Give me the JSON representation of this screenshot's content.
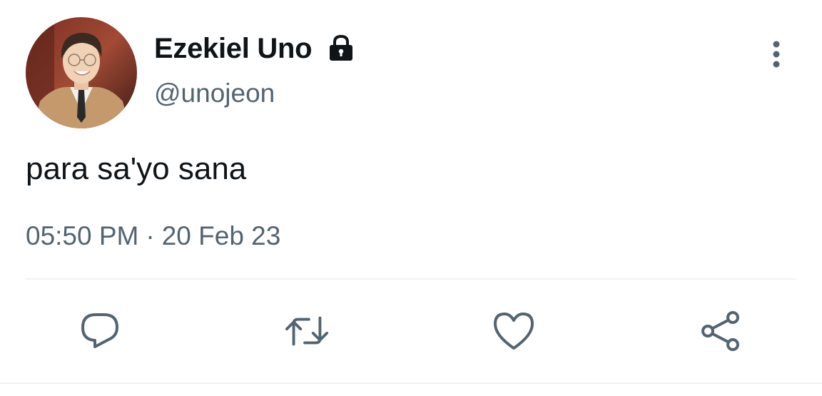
{
  "tweet": {
    "author": {
      "display_name": "Ezekiel Uno",
      "handle": "@unojeon",
      "protected_icon": "lock-icon",
      "avatar": "avatar"
    },
    "text": "para sa'yo sana",
    "time": "05:50 PM",
    "separator": "·",
    "date": "20 Feb 23",
    "more_icon": "more-vertical-icon"
  },
  "actions": [
    {
      "name": "reply",
      "icon": "reply-icon"
    },
    {
      "name": "retweet",
      "icon": "retweet-icon"
    },
    {
      "name": "like",
      "icon": "heart-icon"
    },
    {
      "name": "share",
      "icon": "share-icon"
    }
  ],
  "colors": {
    "text_primary": "#0f1419",
    "text_secondary": "#536471",
    "divider": "#eff3f4"
  }
}
